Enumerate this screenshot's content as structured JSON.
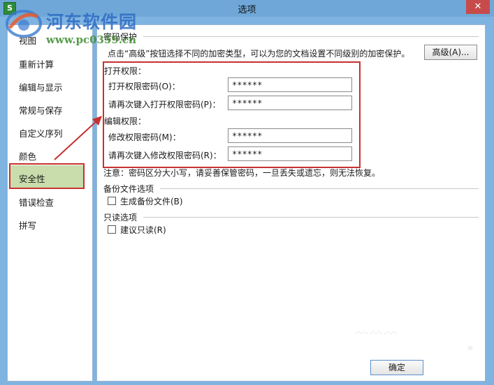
{
  "window": {
    "title": "选项",
    "close_glyph": "✕",
    "app_icon_letter": "S"
  },
  "watermark": {
    "site_name": "河东软件园",
    "url": "www.pc0359.cn"
  },
  "sidebar": {
    "items": [
      {
        "label": "视图"
      },
      {
        "label": "重新计算"
      },
      {
        "label": "编辑与显示"
      },
      {
        "label": "常规与保存"
      },
      {
        "label": "自定义序列"
      },
      {
        "label": "颜色"
      },
      {
        "label": "安全性",
        "selected": true
      },
      {
        "label": "错误检查"
      },
      {
        "label": "拼写"
      }
    ]
  },
  "password_protection": {
    "group_title": "密码保护",
    "description": "点击“高级”按钮选择不同的加密类型，可以为您的文档设置不同级别的加密保护。",
    "advanced_button": "高级(A)...",
    "open_permission": {
      "title": "打开权限：",
      "password_label": "打开权限密码(O)：",
      "password_value": "******",
      "confirm_label": "请再次键入打开权限密码(P)：",
      "confirm_value": "******"
    },
    "edit_permission": {
      "title": "编辑权限：",
      "password_label": "修改权限密码(M)：",
      "password_value": "******",
      "confirm_label": "请再次键入修改权限密码(R)：",
      "confirm_value": "******"
    },
    "note": "注意：密码区分大小写，请妥善保管密码，一旦丢失或遗忘，则无法恢复。"
  },
  "backup": {
    "group_title": "备份文件选项",
    "checkbox_label": "生成备份文件(B)",
    "checked": false
  },
  "readonly": {
    "group_title": "只读选项",
    "checkbox_label": "建议只读(R)",
    "checked": false
  },
  "footer": {
    "ok_button": "确定"
  },
  "colors": {
    "selected_bg": "#c9dcab",
    "annotation": "#c83030",
    "title_bar": "#6fa8d8"
  }
}
